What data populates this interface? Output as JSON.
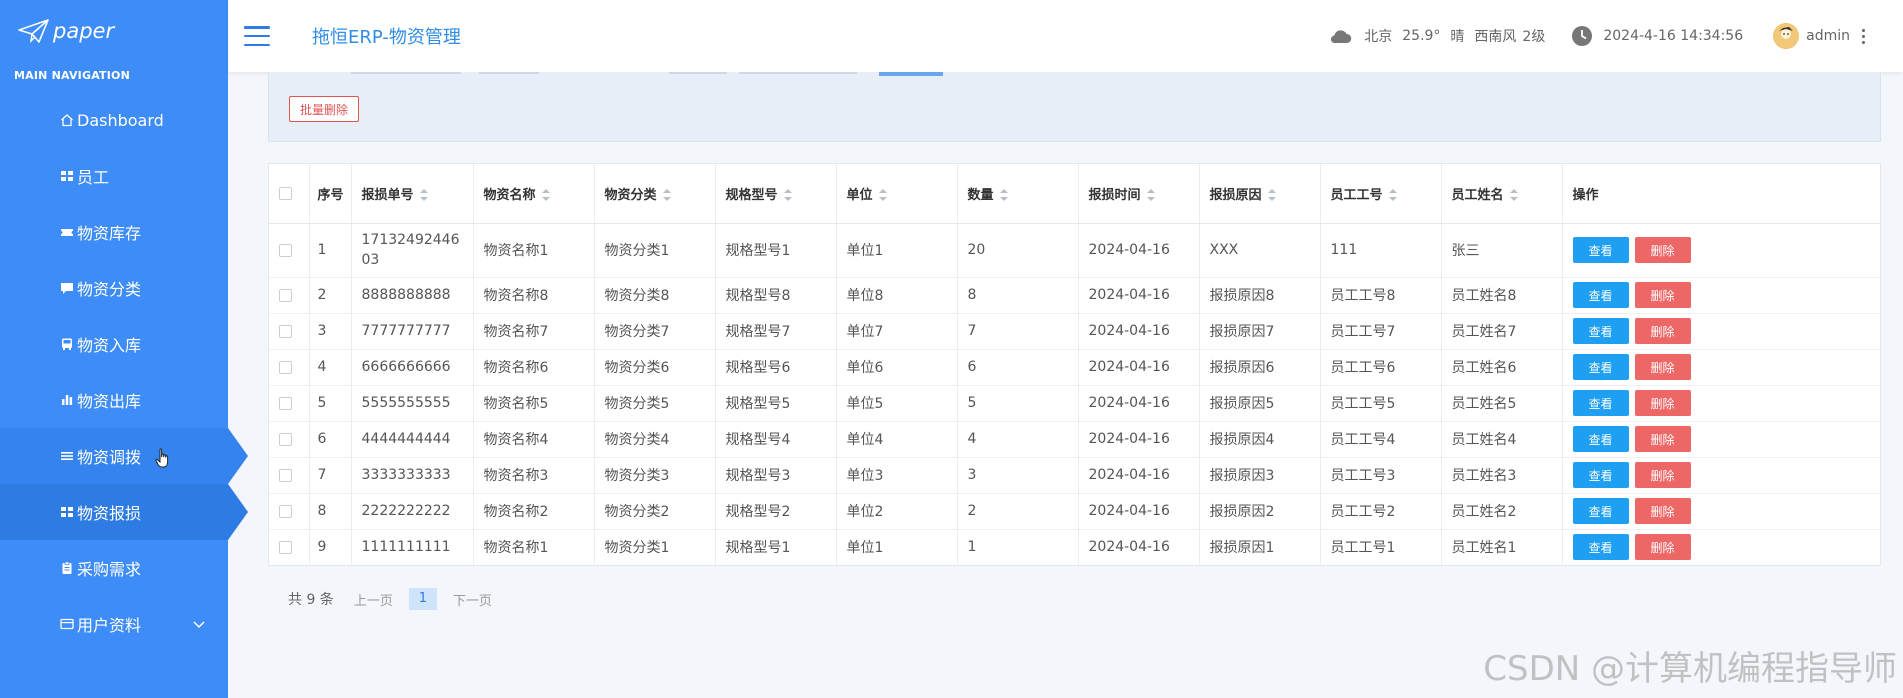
{
  "brand": {
    "name": "paper"
  },
  "sidebar": {
    "caption": "MAIN NAVIGATION",
    "items": [
      {
        "label": "Dashboard",
        "icon": "home-icon"
      },
      {
        "label": "员工",
        "icon": "grid-icon"
      },
      {
        "label": "物资库存",
        "icon": "ticket-icon"
      },
      {
        "label": "物资分类",
        "icon": "comment-icon"
      },
      {
        "label": "物资入库",
        "icon": "bus-icon"
      },
      {
        "label": "物资出库",
        "icon": "bar-chart-icon"
      },
      {
        "label": "物资调拨",
        "icon": "list-icon",
        "state": "hover"
      },
      {
        "label": "物资报损",
        "icon": "grid-icon",
        "state": "active"
      },
      {
        "label": "采购需求",
        "icon": "clipboard-icon"
      },
      {
        "label": "用户资料",
        "icon": "id-card-icon",
        "has_submenu": true
      }
    ]
  },
  "header": {
    "title": "拖恒ERP-物资管理",
    "weather": {
      "city": "北京",
      "temp": "25.9°",
      "condition": "晴",
      "wind": "西南风",
      "level": "2级"
    },
    "datetime": "2024-4-16 14:34:56",
    "user": "admin"
  },
  "toolbar": {
    "batch_delete": "批量删除"
  },
  "table": {
    "columns": [
      "序号",
      "报损单号",
      "物资名称",
      "物资分类",
      "规格型号",
      "单位",
      "数量",
      "报损时间",
      "报损原因",
      "员工工号",
      "员工姓名",
      "操作"
    ],
    "view_label": "查看",
    "delete_label": "删除",
    "rows": [
      [
        "1",
        "1713249244603",
        "物资名称1",
        "物资分类1",
        "规格型号1",
        "单位1",
        "20",
        "2024-04-16",
        "XXX",
        "111",
        "张三"
      ],
      [
        "2",
        "8888888888",
        "物资名称8",
        "物资分类8",
        "规格型号8",
        "单位8",
        "8",
        "2024-04-16",
        "报损原因8",
        "员工工号8",
        "员工姓名8"
      ],
      [
        "3",
        "7777777777",
        "物资名称7",
        "物资分类7",
        "规格型号7",
        "单位7",
        "7",
        "2024-04-16",
        "报损原因7",
        "员工工号7",
        "员工姓名7"
      ],
      [
        "4",
        "6666666666",
        "物资名称6",
        "物资分类6",
        "规格型号6",
        "单位6",
        "6",
        "2024-04-16",
        "报损原因6",
        "员工工号6",
        "员工姓名6"
      ],
      [
        "5",
        "5555555555",
        "物资名称5",
        "物资分类5",
        "规格型号5",
        "单位5",
        "5",
        "2024-04-16",
        "报损原因5",
        "员工工号5",
        "员工姓名5"
      ],
      [
        "6",
        "4444444444",
        "物资名称4",
        "物资分类4",
        "规格型号4",
        "单位4",
        "4",
        "2024-04-16",
        "报损原因4",
        "员工工号4",
        "员工姓名4"
      ],
      [
        "7",
        "3333333333",
        "物资名称3",
        "物资分类3",
        "规格型号3",
        "单位3",
        "3",
        "2024-04-16",
        "报损原因3",
        "员工工号3",
        "员工姓名3"
      ],
      [
        "8",
        "2222222222",
        "物资名称2",
        "物资分类2",
        "规格型号2",
        "单位2",
        "2",
        "2024-04-16",
        "报损原因2",
        "员工工号2",
        "员工姓名2"
      ],
      [
        "9",
        "1111111111",
        "物资名称1",
        "物资分类1",
        "规格型号1",
        "单位1",
        "1",
        "2024-04-16",
        "报损原因1",
        "员工工号1",
        "员工姓名1"
      ]
    ]
  },
  "pagination": {
    "total": "共 9 条",
    "prev": "上一页",
    "current": "1",
    "next": "下一页"
  },
  "watermark": "CSDN @计算机编程指导师",
  "colors": {
    "sidebar": "#3d8cf7",
    "accent": "#2f8de4",
    "view_button": "#1e9ff2",
    "delete_button": "#ee6767"
  }
}
